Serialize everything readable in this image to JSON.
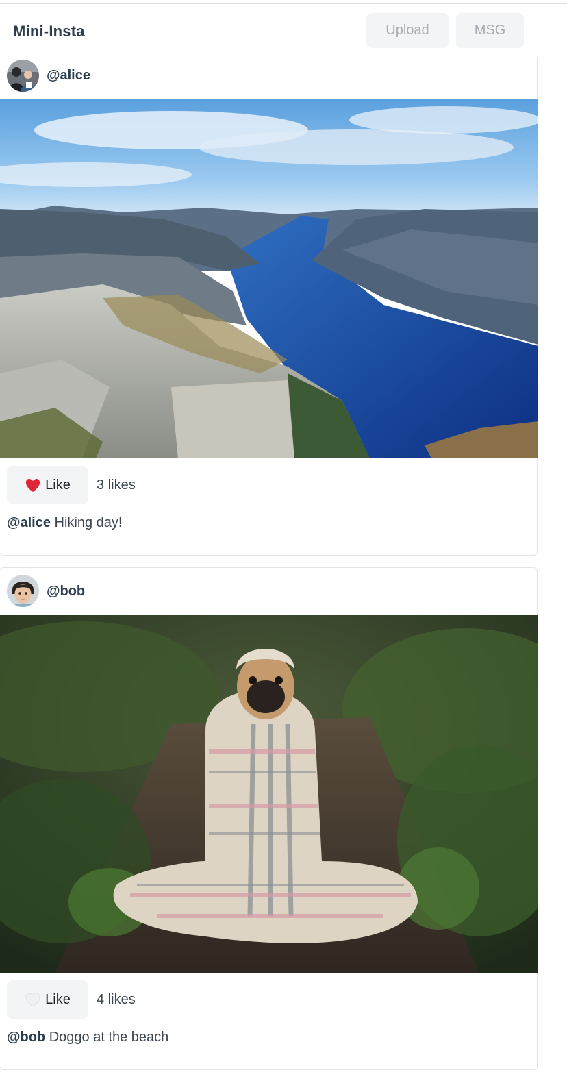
{
  "header": {
    "brand": "Mini-Insta",
    "upload_label": "Upload",
    "msg_label": "MSG"
  },
  "posts": [
    {
      "username": "@alice",
      "like_label": "Like",
      "liked": true,
      "likes_text": "3 likes",
      "caption_user": "@alice",
      "caption_text": " Hiking day!",
      "photo_subject": "fjord-landscape",
      "avatar_icon": "user-avatar"
    },
    {
      "username": "@bob",
      "like_label": "Like",
      "liked": false,
      "likes_text": "4 likes",
      "caption_user": "@bob",
      "caption_text": " Doggo at the beach",
      "photo_subject": "pug-in-blanket",
      "avatar_icon": "user-avatar"
    }
  ],
  "colors": {
    "liked_heart": "#e0243a",
    "unliked_heart": "#f2f2f2",
    "button_bg": "#f3f4f5",
    "text_dark": "#2c3e50"
  }
}
